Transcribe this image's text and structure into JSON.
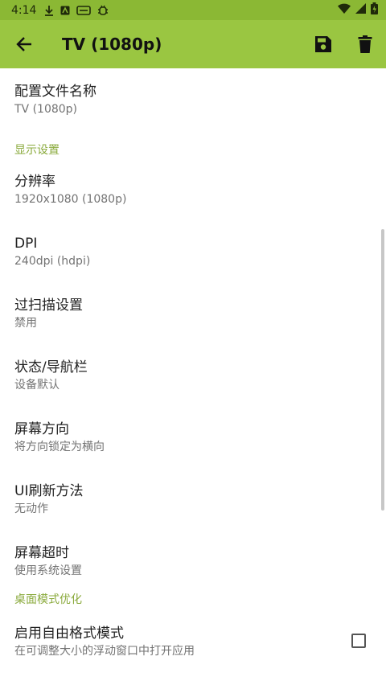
{
  "status": {
    "time": "4:14"
  },
  "appbar": {
    "title": "TV (1080p)"
  },
  "profile": {
    "label": "配置文件名称",
    "value": "TV (1080p)"
  },
  "section_display": "显示设置",
  "prefs": [
    {
      "label": "分辨率",
      "value": "1920x1080 (1080p)"
    },
    {
      "label": "DPI",
      "value": "240dpi (hdpi)"
    },
    {
      "label": "过扫描设置",
      "value": "禁用"
    },
    {
      "label": "状态/导航栏",
      "value": "设备默认"
    },
    {
      "label": "屏幕方向",
      "value": "将方向锁定为横向"
    },
    {
      "label": "UI刷新方法",
      "value": "无动作"
    },
    {
      "label": "屏幕超时",
      "value": "使用系统设置"
    }
  ],
  "section_desktop": "桌面模式优化",
  "freeform": {
    "label": "启用自由格式模式",
    "value": "在可调整大小的浮动窗口中打开应用",
    "checked": false
  }
}
